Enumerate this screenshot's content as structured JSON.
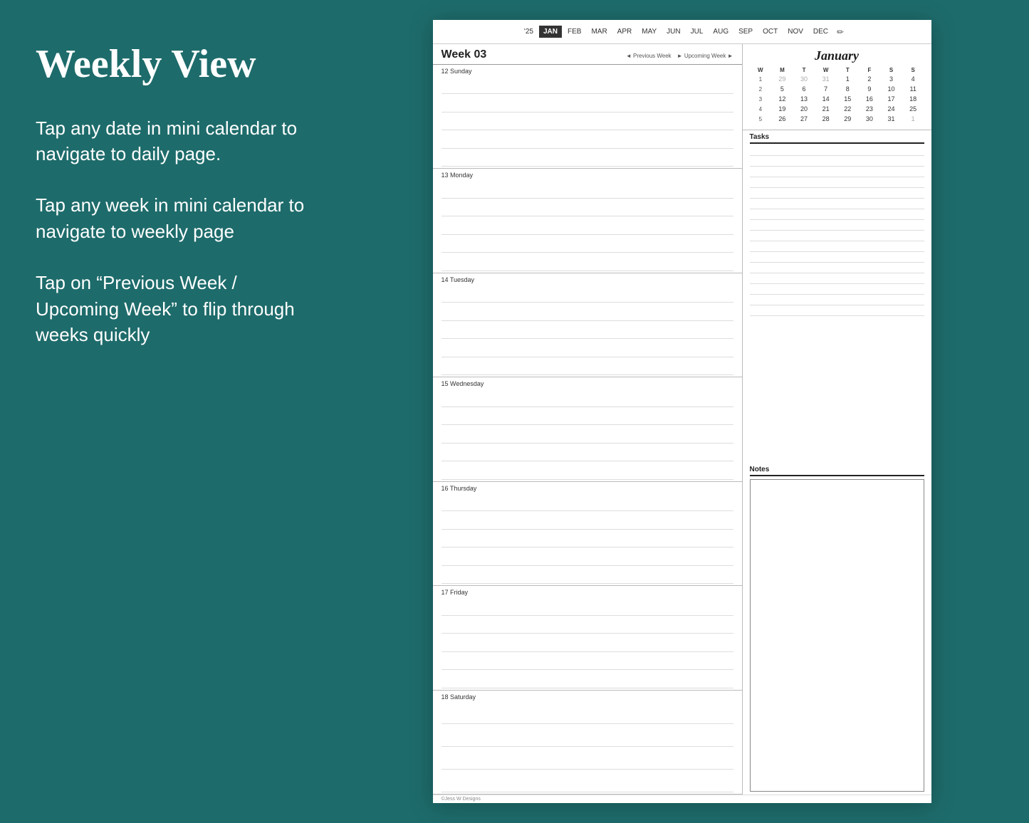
{
  "left": {
    "title": "Weekly View",
    "tip1": "Tap any date in mini calendar to navigate to daily page.",
    "tip2": "Tap any week in mini calendar to navigate to weekly page",
    "tip3": "Tap on “Previous Week / Upcoming Week” to flip through weeks quickly"
  },
  "planner": {
    "month_nav": {
      "year": "'25",
      "months": [
        "JAN",
        "FEB",
        "MAR",
        "APR",
        "MAY",
        "JUN",
        "JUL",
        "AUG",
        "SEP",
        "OCT",
        "NOV",
        "DEC"
      ],
      "active": "JAN"
    },
    "week_header": {
      "label": "Week 03",
      "prev": "◄ Previous Week",
      "next": "► Upcoming Week ►"
    },
    "days": [
      {
        "label": "12 Sunday",
        "lines": 6
      },
      {
        "label": "13 Monday",
        "lines": 6
      },
      {
        "label": "14 Tuesday",
        "lines": 6
      },
      {
        "label": "15 Wednesday",
        "lines": 6
      },
      {
        "label": "16 Thursday",
        "lines": 6
      },
      {
        "label": "17 Friday",
        "lines": 6
      },
      {
        "label": "18 Saturday",
        "lines": 5
      }
    ],
    "mini_calendar": {
      "title": "January",
      "headers": [
        "W",
        "M",
        "T",
        "W",
        "T",
        "F",
        "S",
        "S"
      ],
      "rows": [
        {
          "week": "1",
          "days": [
            "29",
            "30",
            "31",
            "1",
            "2",
            "3",
            "4"
          ],
          "other": [
            true,
            true,
            true,
            false,
            false,
            false,
            false
          ]
        },
        {
          "week": "2",
          "days": [
            "5",
            "6",
            "7",
            "8",
            "9",
            "10",
            "11"
          ],
          "other": [
            false,
            false,
            false,
            false,
            false,
            false,
            false
          ]
        },
        {
          "week": "3",
          "days": [
            "12",
            "13",
            "14",
            "15",
            "16",
            "17",
            "18"
          ],
          "other": [
            false,
            false,
            false,
            false,
            false,
            false,
            false
          ]
        },
        {
          "week": "4",
          "days": [
            "19",
            "20",
            "21",
            "22",
            "23",
            "24",
            "25"
          ],
          "other": [
            false,
            false,
            false,
            false,
            false,
            false,
            false
          ]
        },
        {
          "week": "5",
          "days": [
            "26",
            "27",
            "28",
            "29",
            "30",
            "31",
            "1"
          ],
          "other": [
            false,
            false,
            false,
            false,
            false,
            false,
            true
          ]
        }
      ]
    },
    "tasks_label": "Tasks",
    "task_lines": 16,
    "notes_label": "Notes",
    "footer": "©Jess W Designs"
  }
}
